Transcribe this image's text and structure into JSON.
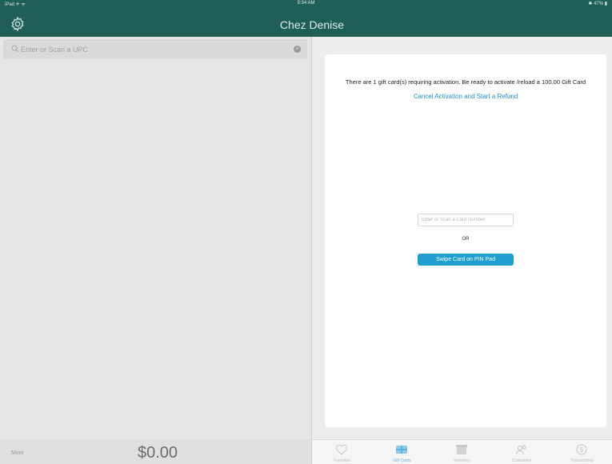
{
  "status_bar": {
    "left": "iPad ✈︎ ᯤ",
    "time": "9:34 AM",
    "right": "✱ 47% ▮"
  },
  "header": {
    "title": "Chez Denise"
  },
  "search": {
    "placeholder": "Enter or Scan a UPC"
  },
  "gift_card": {
    "message": "There are 1 gift card(s) requiring activation. Be ready to activate /reload a 100.00 Gift Card",
    "cancel_link": "Cancel Activation and Start a Refund",
    "card_number_placeholder": "Enter or Scan a Card Number",
    "or_text": "OR",
    "swipe_button": "Swipe Card on PIN Pad"
  },
  "footer": {
    "more_label": "More",
    "total": "$0.00"
  },
  "tabs": [
    {
      "label": "Favorites",
      "icon": "heart-icon",
      "active": false
    },
    {
      "label": "Gift Cards",
      "icon": "gift-card-icon",
      "active": true
    },
    {
      "label": "Inventory",
      "icon": "box-icon",
      "active": false
    },
    {
      "label": "Customers",
      "icon": "customers-icon",
      "active": false
    },
    {
      "label": "Transactions",
      "icon": "dollar-icon",
      "active": false
    }
  ],
  "colors": {
    "header": "#1f5f56",
    "accent": "#1e9ed0",
    "link": "#1a8ed0"
  }
}
